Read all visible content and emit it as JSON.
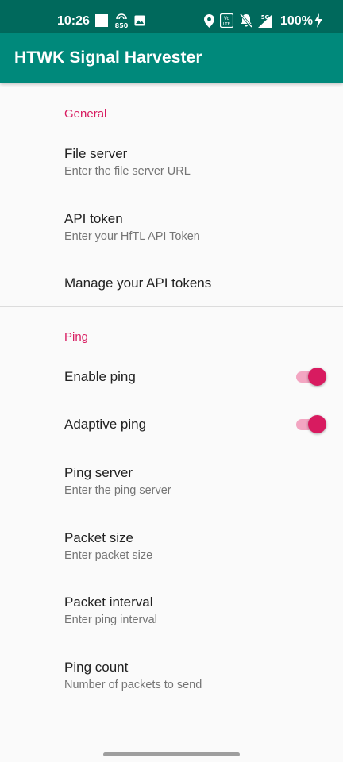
{
  "status_bar": {
    "time": "10:26",
    "badge_850": "850",
    "battery": "100%",
    "icons": [
      "notification-square-icon",
      "hd-850-icon",
      "image-icon",
      "location-icon",
      "volte-icon",
      "mute-icon",
      "signal-5g-icon",
      "battery-charging-icon"
    ],
    "background": "#00695c"
  },
  "app_bar": {
    "title": "HTWK Signal Harvester",
    "background": "#00897b"
  },
  "colors": {
    "accent": "#d81b60",
    "switch_track": "#f3a6c2"
  },
  "general": {
    "header": "General",
    "file_server": {
      "title": "File server",
      "summary": "Enter the file server URL"
    },
    "api_token": {
      "title": "API token",
      "summary": "Enter your HfTL API Token"
    },
    "manage_tokens": {
      "title": "Manage your API tokens"
    }
  },
  "ping": {
    "header": "Ping",
    "enable_ping": {
      "title": "Enable ping",
      "checked": true
    },
    "adaptive_ping": {
      "title": "Adaptive ping",
      "checked": true
    },
    "ping_server": {
      "title": "Ping server",
      "summary": "Enter the ping server"
    },
    "packet_size": {
      "title": "Packet size",
      "summary": "Enter packet size"
    },
    "packet_interval": {
      "title": "Packet interval",
      "summary": "Enter ping interval"
    },
    "ping_count": {
      "title": "Ping count",
      "summary": "Number of packets to send"
    }
  }
}
